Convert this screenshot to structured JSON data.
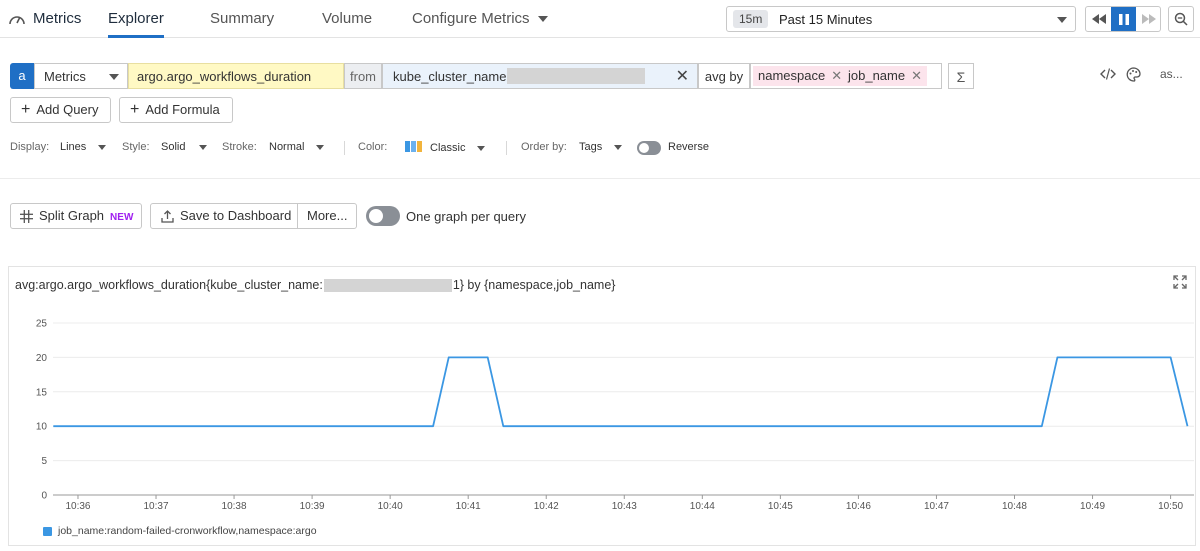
{
  "nav": {
    "logo_label": "Metrics",
    "tabs": [
      "Explorer",
      "Summary",
      "Volume",
      "Configure Metrics"
    ],
    "active_tab": "Explorer"
  },
  "time": {
    "badge": "15m",
    "label": "Past 15 Minutes"
  },
  "query": {
    "letter": "a",
    "source": "Metrics",
    "metric": "argo.argo_workflows_duration",
    "from_label": "from",
    "filter_key": "kube_cluster_name",
    "avg_by_label": "avg by",
    "group_tags": [
      "namespace",
      "job_name"
    ],
    "sigma": "Σ",
    "as_label": "as..."
  },
  "buttons": {
    "add_query": "Add Query",
    "add_formula": "Add Formula",
    "split_graph": "Split Graph",
    "new_badge": "NEW",
    "save_dashboard": "Save to Dashboard",
    "more": "More...",
    "one_graph": "One graph per query"
  },
  "display_opts": {
    "display_label": "Display:",
    "display_value": "Lines",
    "style_label": "Style:",
    "style_value": "Solid",
    "stroke_label": "Stroke:",
    "stroke_value": "Normal",
    "color_label": "Color:",
    "color_value": "Classic",
    "order_label": "Order by:",
    "order_value": "Tags",
    "reverse_label": "Reverse"
  },
  "graph": {
    "title_prefix": "avg:argo.argo_workflows_duration{kube_cluster_name:",
    "title_suffix": "1} by {namespace,job_name}"
  },
  "chart_data": {
    "type": "line",
    "title": "",
    "xlabel": "",
    "ylabel": "",
    "ylim": [
      0,
      25
    ],
    "yticks": [
      0,
      5,
      10,
      15,
      20,
      25
    ],
    "xticks": [
      "10:36",
      "10:37",
      "10:38",
      "10:39",
      "10:40",
      "10:41",
      "10:42",
      "10:43",
      "10:44",
      "10:45",
      "10:46",
      "10:47",
      "10:48",
      "10:49",
      "10:50"
    ],
    "xlim_minutes": [
      35.68,
      50.3
    ],
    "grid": true,
    "legend_position": "bottom-left",
    "series": [
      {
        "name": "job_name:random-failed-cronworkflow,namespace:argo",
        "color": "#3b97e3",
        "points": [
          [
            "10:35:41",
            10
          ],
          [
            "10:40:33",
            10
          ],
          [
            "10:40:45",
            20
          ],
          [
            "10:41:15",
            20
          ],
          [
            "10:41:27",
            10
          ],
          [
            "10:48:21",
            10
          ],
          [
            "10:48:33",
            20
          ],
          [
            "10:50:00",
            20
          ],
          [
            "10:50:13",
            10
          ]
        ]
      }
    ]
  }
}
